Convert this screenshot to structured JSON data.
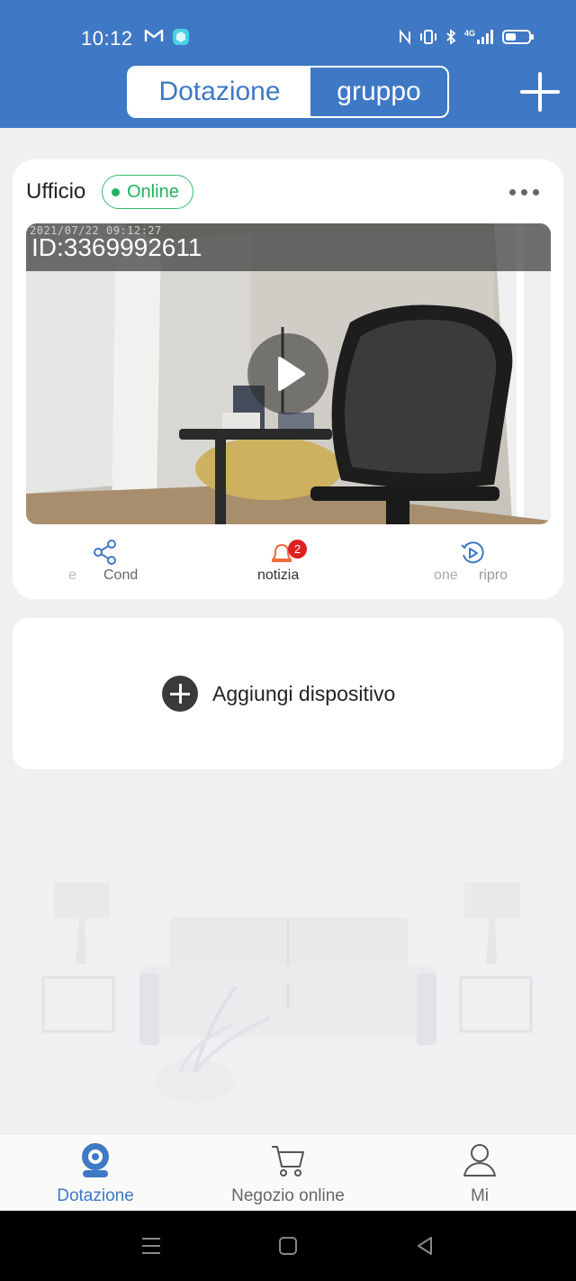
{
  "status_bar": {
    "time": "10:12",
    "left_icons": [
      "gmail-icon",
      "app-cube-icon"
    ],
    "right_icons": [
      "nfc-icon",
      "vibrate-icon",
      "bluetooth-icon",
      "signal-4g-icon",
      "battery-icon"
    ],
    "network": "4G"
  },
  "header": {
    "tab_device": "Dotazione",
    "tab_group": "gruppo",
    "add_icon": "plus-icon"
  },
  "device_card": {
    "name": "Ufficio",
    "status": "Online",
    "video_timestamp": "2021/07/22 09:12:27",
    "video_id": "ID:3369992611",
    "actions": [
      {
        "label": "e",
        "icon": ""
      },
      {
        "label": "Cond",
        "icon": "share-icon"
      },
      {
        "label": "notizia",
        "icon": "bell-icon",
        "badge": "2"
      },
      {
        "label": "one",
        "icon": ""
      },
      {
        "label": "ripro",
        "icon": "playback-icon"
      }
    ]
  },
  "add_device": {
    "label": "Aggiungi dispositivo"
  },
  "tabbar": {
    "items": [
      {
        "label": "Dotazione",
        "icon": "camera-icon",
        "active": true
      },
      {
        "label": "Negozio online",
        "icon": "cart-icon",
        "active": false
      },
      {
        "label": "Mi",
        "icon": "user-icon",
        "active": false
      }
    ]
  },
  "colors": {
    "brand": "#3f78c5",
    "online": "#23b25e",
    "badge": "#e02020",
    "alert_orange": "#f06a3a"
  }
}
